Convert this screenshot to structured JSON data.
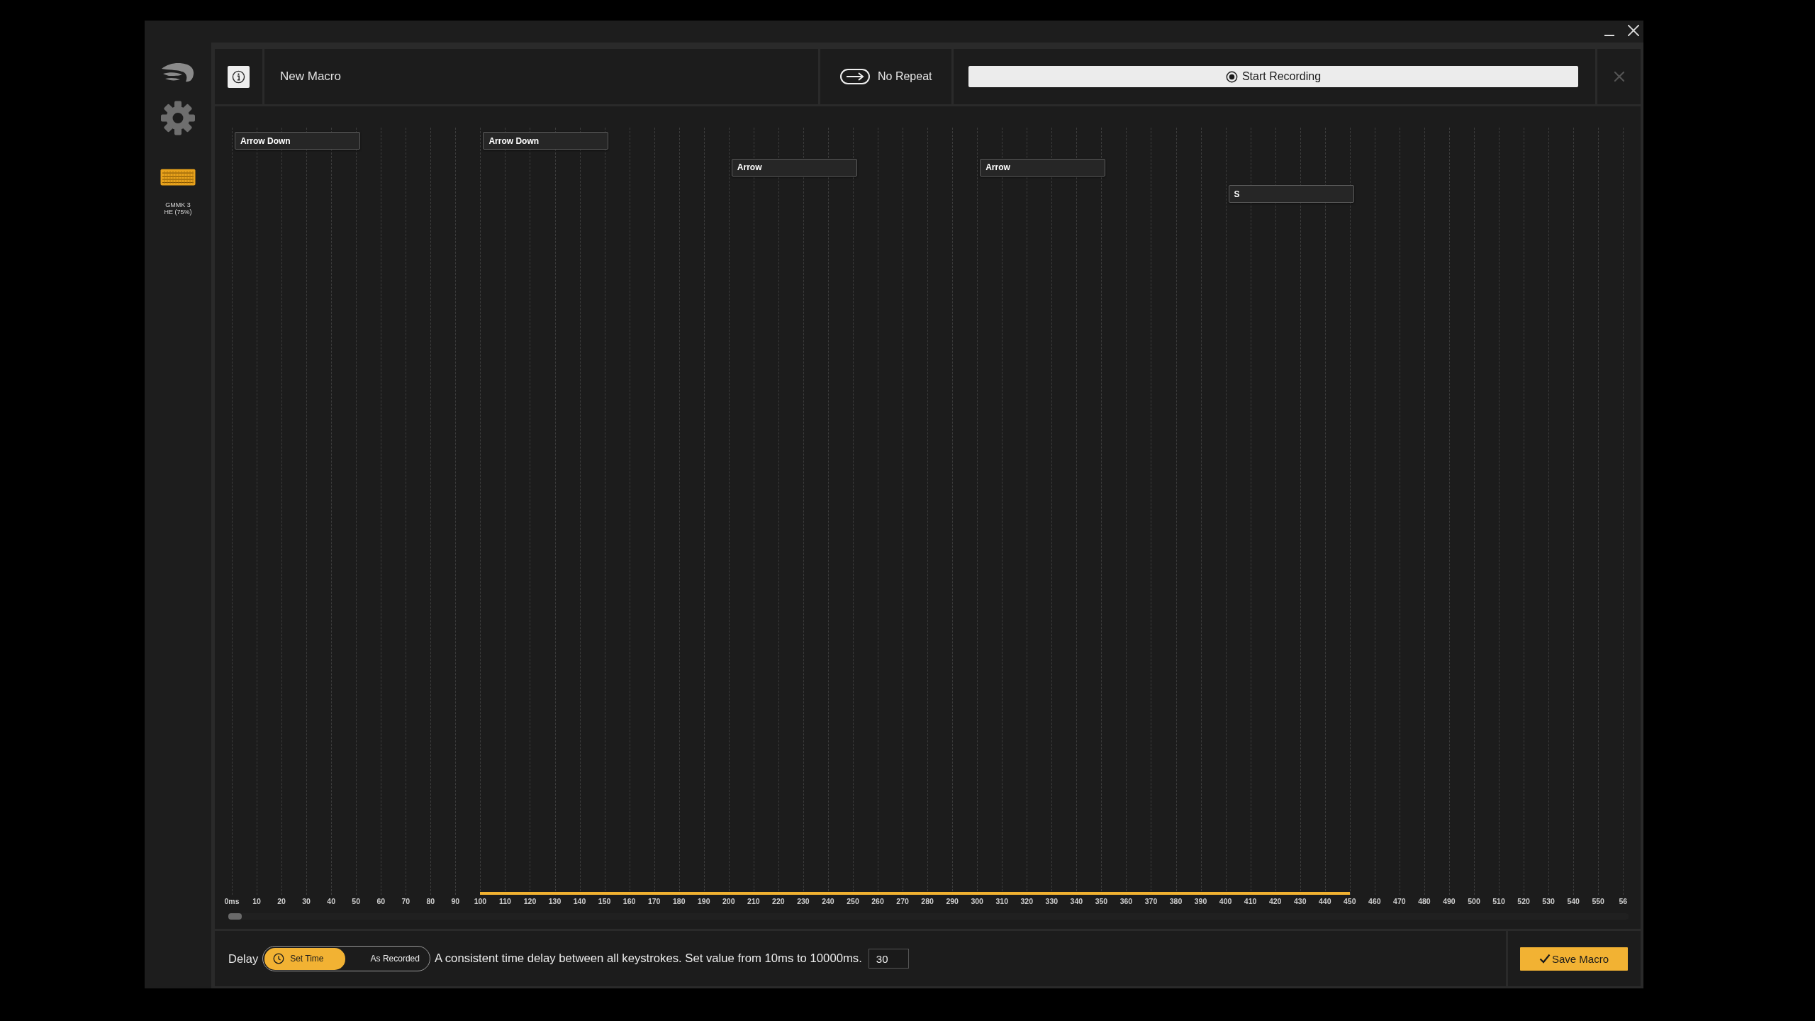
{
  "sidebar": {
    "device_label": "GMMK 3\nHE (75%)"
  },
  "header": {
    "macro_name": "New Macro",
    "repeat": {
      "label": "No Repeat"
    },
    "record_button": {
      "label": "Start Recording"
    }
  },
  "timeline": {
    "events": [
      {
        "label": "Arrow Down"
      },
      {
        "label": "Arrow Down"
      },
      {
        "label": "Arrow"
      },
      {
        "label": "Arrow"
      },
      {
        "label": "S"
      }
    ],
    "ticks": [
      "0ms",
      "10",
      "20",
      "30",
      "40",
      "50",
      "60",
      "70",
      "80",
      "90",
      "100",
      "110",
      "120",
      "130",
      "140",
      "150",
      "160",
      "170",
      "180",
      "190",
      "200",
      "210",
      "220",
      "230",
      "240",
      "250",
      "260",
      "270",
      "280",
      "290",
      "300",
      "310",
      "320",
      "330",
      "340",
      "350",
      "360",
      "370",
      "380",
      "390",
      "400",
      "410",
      "420",
      "430",
      "440",
      "450",
      "460",
      "470",
      "480",
      "490",
      "500",
      "510",
      "520",
      "530",
      "540",
      "550",
      "56"
    ]
  },
  "delay": {
    "label": "Delay",
    "modes": [
      {
        "label": "Set Time",
        "selected": true
      },
      {
        "label": "As Recorded",
        "selected": false
      }
    ],
    "description": "A consistent time delay between all keystrokes. Set value from 10ms to 10000ms.",
    "value": "30"
  },
  "save_button": {
    "label": "Save Macro"
  }
}
